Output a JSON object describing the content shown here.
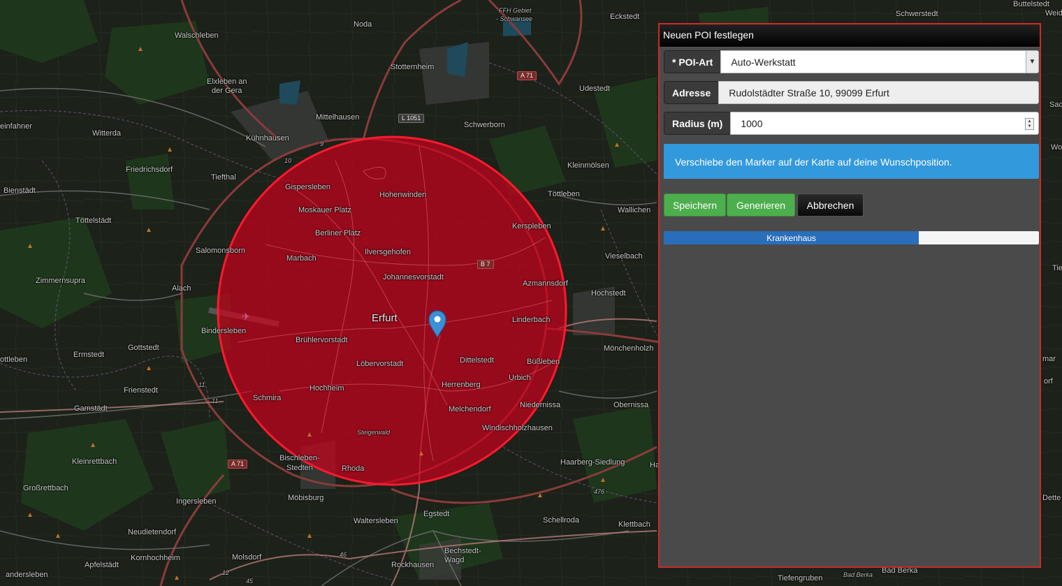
{
  "map": {
    "labels": [
      {
        "text": "Walschleben",
        "cls": ""
      },
      {
        "text": "Noda",
        "cls": ""
      },
      {
        "text": "Stotternheim",
        "cls": ""
      },
      {
        "text": "Elxleben an",
        "cls": ""
      },
      {
        "text": "der Gera",
        "cls": ""
      },
      {
        "text": "Mittelhausen",
        "cls": ""
      },
      {
        "text": "Schwerborn",
        "cls": ""
      },
      {
        "text": "Udestedt",
        "cls": ""
      },
      {
        "text": "Eckstedt",
        "cls": ""
      },
      {
        "text": "Schwerstedt",
        "cls": ""
      },
      {
        "text": "Buttelstedt",
        "cls": ""
      },
      {
        "text": "FFH Gebiet",
        "cls": "small"
      },
      {
        "text": "- Schwansee",
        "cls": "small"
      },
      {
        "text": "einfahner",
        "cls": ""
      },
      {
        "text": "Witterda",
        "cls": ""
      },
      {
        "text": "Kühnhausen",
        "cls": ""
      },
      {
        "text": "Friedrichsdorf",
        "cls": ""
      },
      {
        "text": "Tiefthal",
        "cls": ""
      },
      {
        "text": "Kleinmölsen",
        "cls": ""
      },
      {
        "text": "Töttleben",
        "cls": ""
      },
      {
        "text": "Wallichen",
        "cls": ""
      },
      {
        "text": "Bienstädt",
        "cls": ""
      },
      {
        "text": "Gispersleben",
        "cls": ""
      },
      {
        "text": "Hohenwinden",
        "cls": ""
      },
      {
        "text": "Moskauer Platz",
        "cls": ""
      },
      {
        "text": "Töttelstädt",
        "cls": ""
      },
      {
        "text": "Berliner Platz",
        "cls": ""
      },
      {
        "text": "Kerspleben",
        "cls": ""
      },
      {
        "text": "Salomonsborn",
        "cls": ""
      },
      {
        "text": "Ilversgehofen",
        "cls": ""
      },
      {
        "text": "Marbach",
        "cls": ""
      },
      {
        "text": "Vieselbach",
        "cls": ""
      },
      {
        "text": "Zimmernsupra",
        "cls": ""
      },
      {
        "text": "Johannesvorstadt",
        "cls": ""
      },
      {
        "text": "Alach",
        "cls": ""
      },
      {
        "text": "Azmannsdorf",
        "cls": ""
      },
      {
        "text": "Hochstedt",
        "cls": ""
      },
      {
        "text": "Erfurt",
        "cls": "city"
      },
      {
        "text": "Linderbach",
        "cls": ""
      },
      {
        "text": "Bindersleben",
        "cls": ""
      },
      {
        "text": "Brühlervorstadt",
        "cls": ""
      },
      {
        "text": "Gottstedt",
        "cls": ""
      },
      {
        "text": "Mönchenholzh",
        "cls": ""
      },
      {
        "text": "ottleben",
        "cls": ""
      },
      {
        "text": "Ermstedt",
        "cls": ""
      },
      {
        "text": "Dittelstedt",
        "cls": ""
      },
      {
        "text": "Büßleben",
        "cls": ""
      },
      {
        "text": "Löbervorstadt",
        "cls": ""
      },
      {
        "text": "Urbich",
        "cls": ""
      },
      {
        "text": "Frienstedt",
        "cls": ""
      },
      {
        "text": "Herrenberg",
        "cls": ""
      },
      {
        "text": "Hochheim",
        "cls": ""
      },
      {
        "text": "Schmira",
        "cls": ""
      },
      {
        "text": "Niedernissa",
        "cls": ""
      },
      {
        "text": "Obernissa",
        "cls": ""
      },
      {
        "text": "Gamstädt",
        "cls": ""
      },
      {
        "text": "Melchendorf",
        "cls": ""
      },
      {
        "text": "Windischholzhausen",
        "cls": ""
      },
      {
        "text": "Steigerwald",
        "cls": "small"
      },
      {
        "text": "Kleinrettbach",
        "cls": ""
      },
      {
        "text": "Bischleben-",
        "cls": ""
      },
      {
        "text": "Stedten",
        "cls": ""
      },
      {
        "text": "Rhoda",
        "cls": ""
      },
      {
        "text": "Haarberg-Siedlung",
        "cls": ""
      },
      {
        "text": "Großrettbach",
        "cls": ""
      },
      {
        "text": "Möbisburg",
        "cls": ""
      },
      {
        "text": "Ingersleben",
        "cls": ""
      },
      {
        "text": "Egstedt",
        "cls": ""
      },
      {
        "text": "Waltersleben",
        "cls": ""
      },
      {
        "text": "Schellroda",
        "cls": ""
      },
      {
        "text": "Klettbach",
        "cls": ""
      },
      {
        "text": "Neudietendorf",
        "cls": ""
      },
      {
        "text": "Bechstedt-",
        "cls": ""
      },
      {
        "text": "Wagd",
        "cls": ""
      },
      {
        "text": "Kornhochheim",
        "cls": ""
      },
      {
        "text": "Molsdorf",
        "cls": ""
      },
      {
        "text": "Apfelstädt",
        "cls": ""
      },
      {
        "text": "Rockhausen",
        "cls": ""
      },
      {
        "text": "Tiefengruben",
        "cls": ""
      },
      {
        "text": "Bad Berka",
        "cls": ""
      },
      {
        "text": "Bad Berka",
        "cls": "small"
      },
      {
        "text": "andersleben",
        "cls": ""
      },
      {
        "text": "Weid",
        "cls": ""
      },
      {
        "text": "Sac",
        "cls": ""
      },
      {
        "text": "Wo",
        "cls": ""
      },
      {
        "text": "Tie",
        "cls": ""
      },
      {
        "text": "mar",
        "cls": ""
      },
      {
        "text": "orf",
        "cls": ""
      },
      {
        "text": "Dette",
        "cls": ""
      },
      {
        "text": "Ha",
        "cls": ""
      }
    ],
    "shields": [
      {
        "text": "A 71",
        "gray": false
      },
      {
        "text": "L 1051",
        "gray": true
      },
      {
        "text": "B 7",
        "gray": false
      },
      {
        "text": "A 71",
        "gray": false
      }
    ],
    "road_numbers": [
      "9",
      "10",
      "11",
      "11",
      "476",
      "46",
      "45",
      "12"
    ],
    "radius_circle_color": "#d0001c",
    "marker_color": "#3a8fd6"
  },
  "panel": {
    "title": "Neuen POI festlegen",
    "poi_type_label": "* POI-Art",
    "poi_type_value": "Auto-Werkstatt",
    "address_label": "Adresse",
    "address_value": "Rudolstädter Straße 10, 99099 Erfurt",
    "radius_label": "Radius (m)",
    "radius_value": "1000",
    "info_text": "Verschiebe den Marker auf der Karte auf deine Wunschposition.",
    "save_label": "Speichern",
    "generate_label": "Generieren",
    "cancel_label": "Abbrechen",
    "progress_label": "Krankenhaus",
    "progress_fraction": 0.68,
    "progress_color": "#2a6ebb",
    "info_color": "#3399dd",
    "button_green": "#4cae4c"
  }
}
